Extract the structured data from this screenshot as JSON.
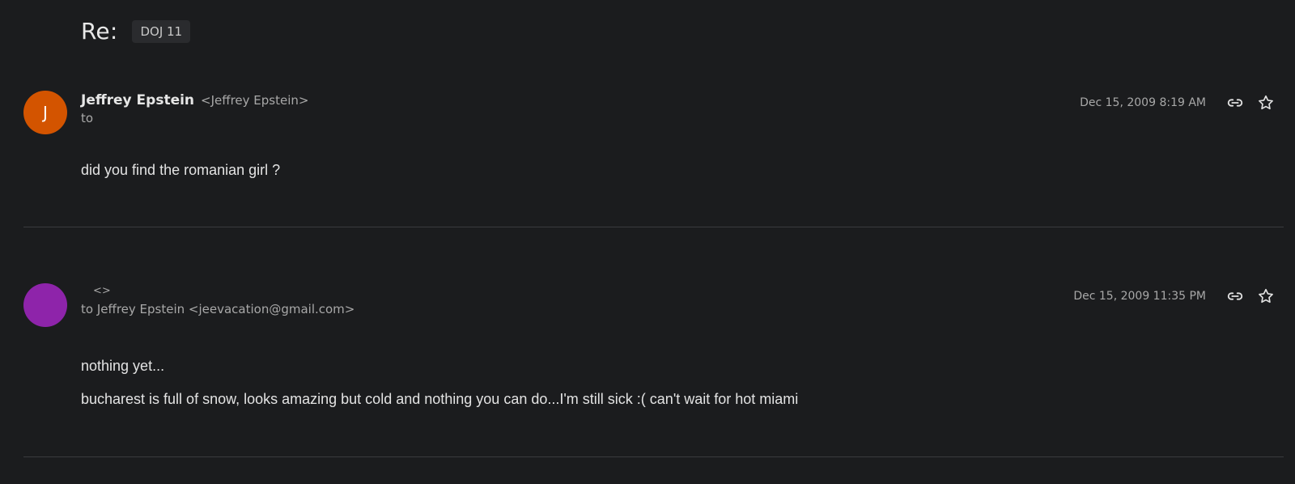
{
  "thread": {
    "subject": "Re:",
    "label": "DOJ 11"
  },
  "messages": [
    {
      "avatar_initial": "J",
      "avatar_color": "#d35400",
      "sender_name": "Jeffrey Epstein",
      "sender_email": "<Jeffrey Epstein>",
      "to": "to",
      "date": "Dec 15, 2009 8:19 AM",
      "body": [
        "did you find the romanian girl ?"
      ]
    },
    {
      "avatar_initial": "",
      "avatar_color": "#8e24aa",
      "sender_name": "",
      "sender_email": "<>",
      "to": "to Jeffrey Epstein <jeevacation@gmail.com>",
      "date": "Dec 15, 2009 11:35 PM",
      "body": [
        "nothing yet...",
        "bucharest is full of snow, looks amazing but cold and nothing you can do...I'm still sick :( can't wait for hot miami"
      ]
    }
  ],
  "icons": {
    "link": "link-icon",
    "star": "star-icon"
  }
}
